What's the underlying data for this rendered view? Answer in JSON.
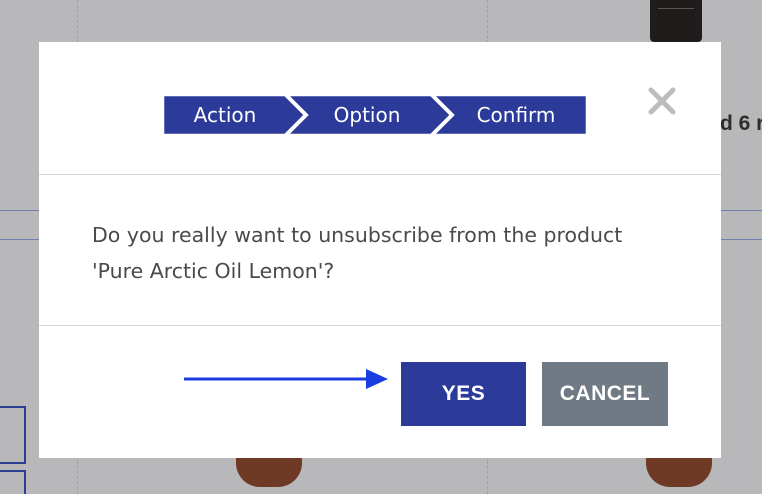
{
  "background": {
    "partial_text": "d 6 r"
  },
  "dialog": {
    "steps": [
      {
        "label": "Action"
      },
      {
        "label": "Option"
      },
      {
        "label": "Confirm"
      }
    ],
    "close_icon": "close-icon",
    "message_line1": "Do you really want to unsubscribe from the product",
    "message_line2": "'Pure Arctic Oil Lemon'?",
    "yes_label": "YES",
    "cancel_label": "CANCEL"
  },
  "colors": {
    "step_fill": "#2c3a9a",
    "yes_button": "#2c3a9a",
    "cancel_button": "#6f7a84",
    "arrow": "#1a3ce0",
    "overlay": "#b8b8bb"
  }
}
